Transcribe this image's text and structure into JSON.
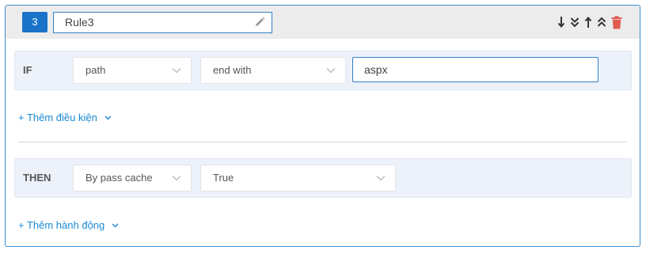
{
  "rule": {
    "number": "3",
    "name": "Rule3",
    "icons": [
      "pencil-icon",
      "arrow-down-icon",
      "double-chevron-down-icon",
      "arrow-up-icon",
      "double-chevron-up-icon",
      "trash-icon"
    ],
    "colors": {
      "accent": "#1a73c9",
      "border": "#3b8fd0",
      "delete": "#e05a4f",
      "link": "#1a8ad4"
    }
  },
  "if_block": {
    "label": "IF",
    "field": "path",
    "operator": "end with",
    "value": "aspx"
  },
  "add_condition": "+ Thêm điều kiện",
  "then_block": {
    "label": "THEN",
    "action": "By pass cache",
    "value": "True"
  },
  "add_action": "+ Thêm hành động"
}
